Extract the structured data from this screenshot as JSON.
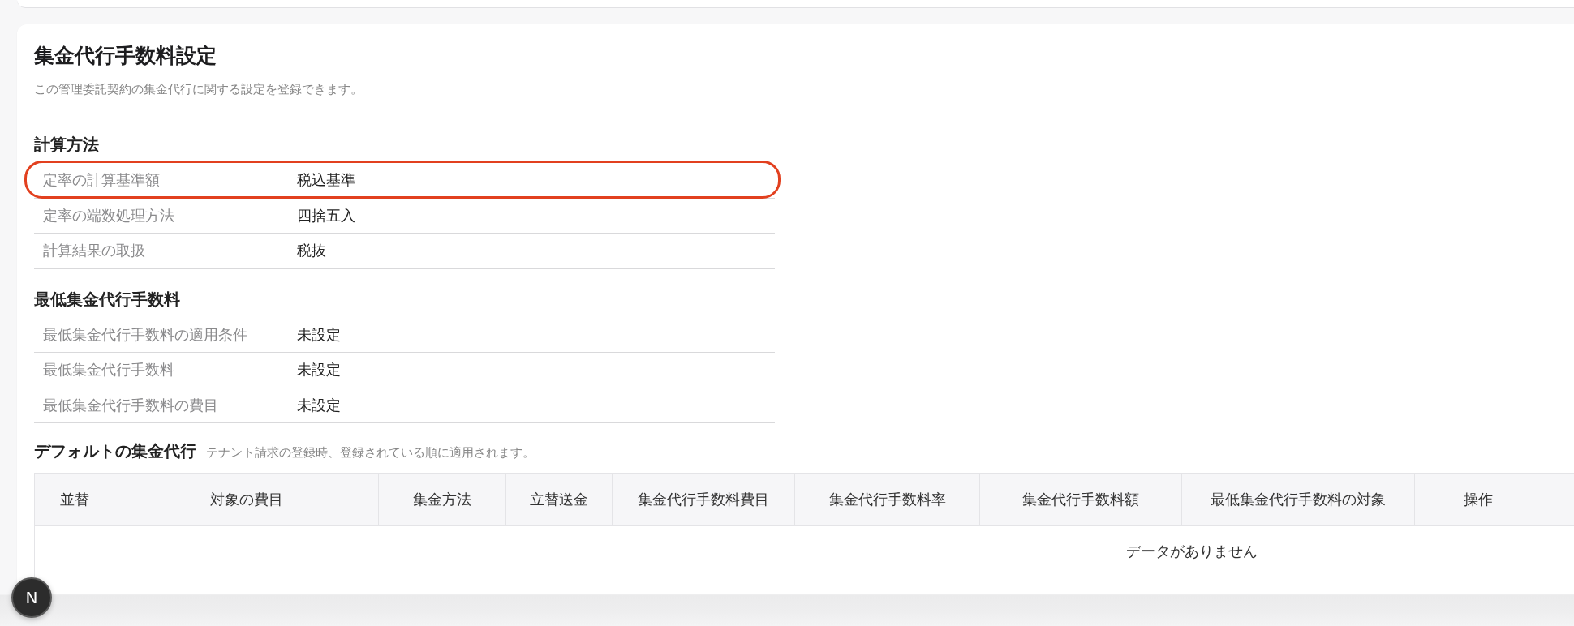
{
  "page": {
    "title": "集金代行手数料設定",
    "description": "この管理委託契約の集金代行に関する設定を登録できます。"
  },
  "sections": [
    {
      "heading": "計算方法",
      "rows": [
        {
          "label": "定率の計算基準額",
          "value": "税込基準",
          "highlighted": true
        },
        {
          "label": "定率の端数処理方法",
          "value": "四捨五入",
          "highlighted": false
        },
        {
          "label": "計算結果の取扱",
          "value": "税抜",
          "highlighted": false
        }
      ]
    },
    {
      "heading": "最低集金代行手数料",
      "rows": [
        {
          "label": "最低集金代行手数料の適用条件",
          "value": "未設定",
          "highlighted": false
        },
        {
          "label": "最低集金代行手数料",
          "value": "未設定",
          "highlighted": false
        },
        {
          "label": "最低集金代行手数料の費目",
          "value": "未設定",
          "highlighted": false
        }
      ]
    }
  ],
  "default_collection": {
    "heading": "デフォルトの集金代行",
    "note": "テナント請求の登録時、登録されている順に適用されます。",
    "table": {
      "columns": [
        "並替",
        "対象の費目",
        "集金方法",
        "立替送金",
        "集金代行手数料費目",
        "集金代行手数料率",
        "集金代行手数料額",
        "最低集金代行手数料の対象",
        "操作"
      ],
      "empty_message": "データがありません"
    }
  },
  "dev_indicator": {
    "label": "N"
  }
}
